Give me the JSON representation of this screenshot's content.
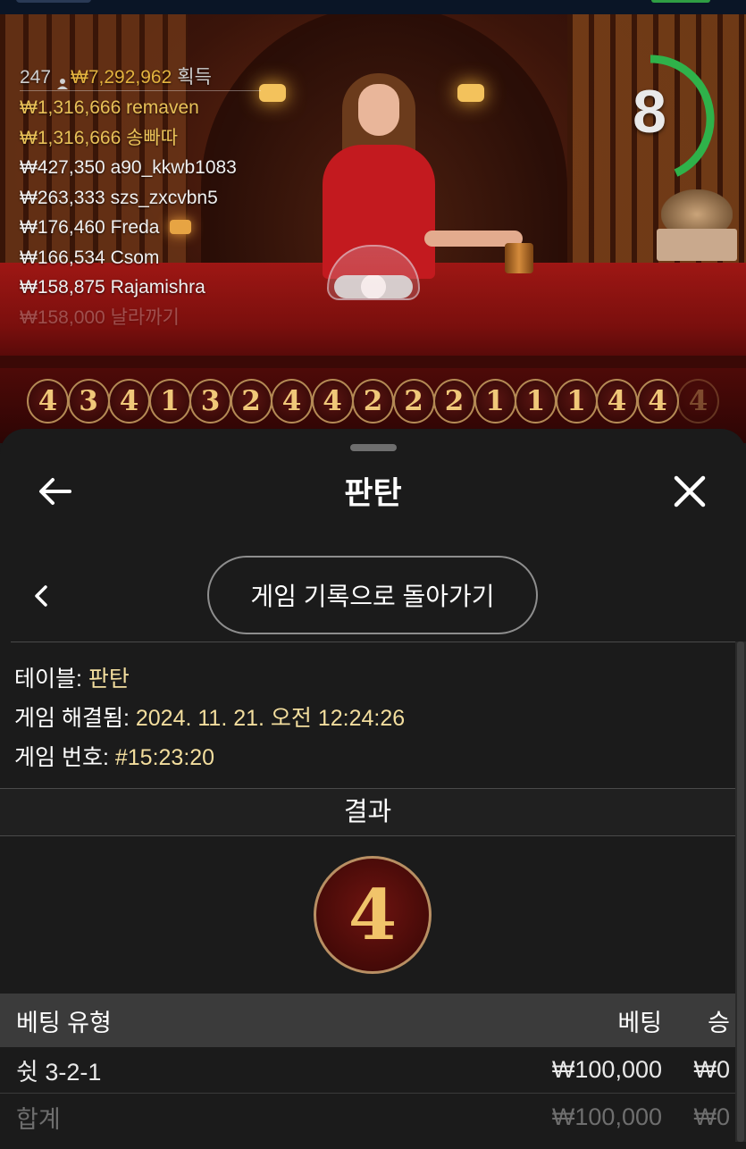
{
  "leaderboard": {
    "player_count": "247",
    "total_won": "₩7,292,962",
    "won_label": "획득",
    "rows": [
      {
        "amount": "₩1,316,666",
        "name": "remaven"
      },
      {
        "amount": "₩1,316,666",
        "name": "송빠따"
      },
      {
        "amount": "₩427,350",
        "name": "a90_kkwb1083"
      },
      {
        "amount": "₩263,333",
        "name": "szs_zxcvbn5"
      },
      {
        "amount": "₩176,460",
        "name": "Freda"
      },
      {
        "amount": "₩166,534",
        "name": "Csom"
      },
      {
        "amount": "₩158,875",
        "name": "Rajamishra"
      },
      {
        "amount": "₩158,000",
        "name": "날라까기"
      }
    ]
  },
  "timer": {
    "seconds": "8",
    "progress_fraction": 0.43
  },
  "history_beads": [
    "4",
    "3",
    "4",
    "1",
    "3",
    "2",
    "4",
    "4",
    "2",
    "2",
    "2",
    "1",
    "1",
    "1",
    "4",
    "4",
    "4"
  ],
  "sheet": {
    "title": "판탄",
    "back_to_history_label": "게임 기록으로 돌아가기"
  },
  "game_info": {
    "table_label": "테이블:",
    "table_value": "판탄",
    "resolved_label": "게임 해결됨:",
    "resolved_value": "2024. 11. 21. 오전 12:24:26",
    "number_label": "게임 번호:",
    "number_value": "#15:23:20"
  },
  "result": {
    "header": "결과",
    "value": "4"
  },
  "bets": {
    "headers": {
      "type": "베팅 유형",
      "bet": "베팅",
      "win": "승"
    },
    "rows": [
      {
        "type": "쉿 3-2-1",
        "bet": "₩100,000",
        "win": "₩0"
      }
    ],
    "total": {
      "type": "합계",
      "bet": "₩100,000",
      "win": "₩0"
    }
  },
  "colors": {
    "gold_text": "#e8c158",
    "info_value": "#f3de9e",
    "timer_ring": "#2fb24a",
    "sheet_bg": "#1b1b1b"
  },
  "icons": [
    "user-icon",
    "back-arrow-icon",
    "close-icon",
    "chevron-left-icon"
  ]
}
